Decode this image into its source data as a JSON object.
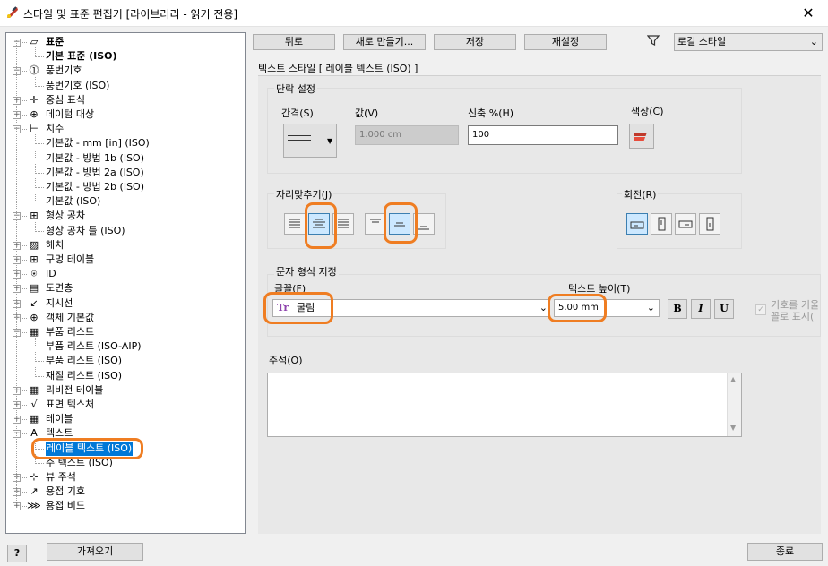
{
  "window": {
    "title": "스타일 및 표준 편집기 [라이브러리 - 읽기 전용]",
    "close": "✕"
  },
  "tree": [
    {
      "label": "표준",
      "bold": true
    },
    {
      "label": "기본 표준 (ISO)",
      "bold": true
    },
    {
      "label": "풍번기호"
    },
    {
      "label": "풍번기호 (ISO)"
    },
    {
      "label": "중심 표식"
    },
    {
      "label": "데이텀 대상"
    },
    {
      "label": "치수"
    },
    {
      "label": "기본값 - mm [in] (ISO)"
    },
    {
      "label": "기본값 - 방법 1b (ISO)"
    },
    {
      "label": "기본값 - 방법 2a (ISO)"
    },
    {
      "label": "기본값 - 방법 2b (ISO)"
    },
    {
      "label": "기본값 (ISO)"
    },
    {
      "label": "형상 공차"
    },
    {
      "label": "형상 공차 틀 (ISO)"
    },
    {
      "label": "해치"
    },
    {
      "label": "구멍 테이블"
    },
    {
      "label": "ID"
    },
    {
      "label": "도면층"
    },
    {
      "label": "지시선"
    },
    {
      "label": "객체 기본값"
    },
    {
      "label": "부품 리스트"
    },
    {
      "label": "부품 리스트 (ISO-AIP)"
    },
    {
      "label": "부품 리스트 (ISO)"
    },
    {
      "label": "재질 리스트 (ISO)"
    },
    {
      "label": "리비전 테이블"
    },
    {
      "label": "표면 텍스처"
    },
    {
      "label": "테이블"
    },
    {
      "label": "텍스트"
    },
    {
      "label": "레이블 텍스트 (ISO)",
      "selected": true
    },
    {
      "label": "주 텍스트 (ISO)"
    },
    {
      "label": "뷰 주석"
    },
    {
      "label": "용접 기호"
    },
    {
      "label": "용접 비드"
    }
  ],
  "toolbar": {
    "back": "뒤로",
    "new": "새로 만들기...",
    "save": "저장",
    "reset": "재설정",
    "filter_value": "로컬 스타일"
  },
  "panel": {
    "header": "텍스트 스타일 [ 레이블 텍스트 (ISO) ]",
    "paragraph": {
      "title": "단락 설정",
      "spacing_label": "간격(S)",
      "value_label": "값(V)",
      "value": "1.000 cm",
      "stretch_label": "신축 %(H)",
      "stretch": "100",
      "color_label": "색상(C)"
    },
    "justify": {
      "title": "자리맞추기(J)"
    },
    "rotation": {
      "title": "회전(R)"
    },
    "format": {
      "title": "문자 형식 지정",
      "font_label": "글꼴(F)",
      "font_value": "굴림",
      "height_label": "텍스트 높이(T)",
      "height_value": "5.00 mm",
      "bold": "B",
      "italic": "I",
      "underline": "U",
      "symbol_label_1": "기호를 기울",
      "symbol_label_2": "꼴로 표시("
    },
    "comment": {
      "title": "주석(O)"
    }
  },
  "footer": {
    "help": "?",
    "import": "가져오기",
    "done": "종료"
  },
  "colors": {
    "accent": "#ef7d22",
    "selection": "#0078d7"
  }
}
